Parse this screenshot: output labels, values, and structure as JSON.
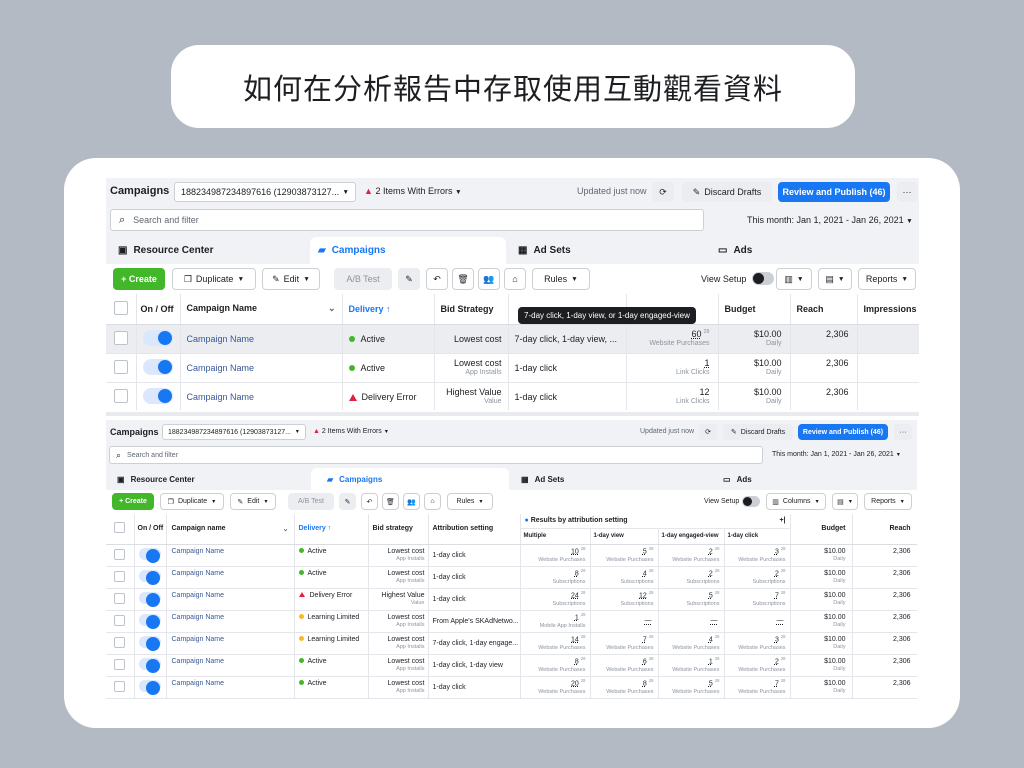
{
  "page_title": "如何在分析報告中存取使用互動觀看資料",
  "colors": {
    "accent": "#1877f2",
    "create": "#42b72a",
    "error": "#e41e3f",
    "active": "#42b72a",
    "limited": "#f7b928"
  },
  "shot1": {
    "toolbar": {
      "title": "Campaigns",
      "account": "188234987234897616 (12903873127...",
      "errors": "2 Items With Errors",
      "updated": "Updated just now",
      "discard": "Discard Drafts",
      "publish": "Review and Publish (46)",
      "more": "···"
    },
    "search": {
      "placeholder": "Search and filter",
      "date": "This month: Jan 1, 2021 - Jan 26, 2021"
    },
    "tabs": [
      "Resource Center",
      "Campaigns",
      "Ad Sets",
      "Ads"
    ],
    "actions": {
      "create": "+ Create",
      "duplicate": "Duplicate",
      "edit": "Edit",
      "ab": "A/B Test",
      "rules": "Rules",
      "view_setup": "View Setup",
      "reports": "Reports"
    },
    "tooltip": "7-day click, 1-day view, or 1-day engaged-view",
    "headers": [
      "On / Off",
      "Campaign Name",
      "Delivery ↑",
      "Bid Strategy",
      "",
      "",
      "Budget",
      "Reach",
      "Impressions"
    ],
    "rows": [
      {
        "name": "Campaign Name",
        "delivery": "Active",
        "bid": "Lowest cost",
        "bid_sub": "",
        "attr": "7-day click, 1-day view, ...",
        "result": "60",
        "result_sup": "28",
        "result_sub": "Website Purchases",
        "budget": "$10.00",
        "budget_sub": "Daily",
        "reach": "2,306"
      },
      {
        "name": "Campaign Name",
        "delivery": "Active",
        "bid": "Lowest cost",
        "bid_sub": "App Installs",
        "attr": "1-day click",
        "result": "1",
        "result_sup": "",
        "result_sub": "Link Clicks",
        "budget": "$10.00",
        "budget_sub": "Daily",
        "reach": "2,306"
      },
      {
        "name": "Campaign Name",
        "delivery": "Delivery Error",
        "bid": "Highest Value",
        "bid_sub": "Value",
        "attr": "1-day click",
        "result": "12",
        "result_sup": "",
        "result_sub": "Link Clicks",
        "budget": "$10.00",
        "budget_sub": "Daily",
        "reach": "2,306"
      }
    ]
  },
  "shot2": {
    "toolbar": {
      "title": "Campaigns",
      "account": "188234987234897616 (12903873127...",
      "errors": "2 Items With Errors",
      "updated": "Updated just now",
      "discard": "Discard Drafts",
      "publish": "Review and Publish (46)",
      "more": "···"
    },
    "search": {
      "placeholder": "Search and filter",
      "date": "This month: Jan 1, 2021 - Jan 26, 2021"
    },
    "tabs": [
      "Resource Center",
      "Campaigns",
      "Ad Sets",
      "Ads"
    ],
    "actions": {
      "create": "+ Create",
      "duplicate": "Duplicate",
      "edit": "Edit",
      "ab": "A/B Test",
      "rules": "Rules",
      "view_setup": "View Setup",
      "columns": "Columns",
      "reports": "Reports"
    },
    "results_label": "Results by attribution setting",
    "headers": [
      "On / Off",
      "Campaign name",
      "Delivery ↑",
      "Bid strategy",
      "Attribution setting",
      "Budget",
      "Reach"
    ],
    "sub_headers": [
      "Multiple",
      "1-day view",
      "1-day engaged-view",
      "1-day click"
    ],
    "rows": [
      {
        "name": "Campaign Name",
        "delivery": "Active",
        "dtype": "active",
        "bid": "Lowest cost",
        "bid_sub": "App Installs",
        "attr": "1-day click",
        "cells": [
          [
            "10",
            "28",
            "Website Purchases"
          ],
          [
            "5",
            "28",
            "Website Purchases"
          ],
          [
            "2",
            "28",
            "Website Purchases"
          ],
          [
            "3",
            "28",
            "Website Purchases"
          ]
        ],
        "budget": "$10.00",
        "reach": "2,306"
      },
      {
        "name": "Campaign Name",
        "delivery": "Active",
        "dtype": "active",
        "bid": "Lowest cost",
        "bid_sub": "App Installs",
        "attr": "1-day click",
        "cells": [
          [
            "8",
            "28",
            "Subscriptions"
          ],
          [
            "4",
            "28",
            "Subscriptions"
          ],
          [
            "2",
            "28",
            "Subscriptions"
          ],
          [
            "2",
            "28",
            "Subscriptions"
          ]
        ],
        "budget": "$10.00",
        "reach": "2,306"
      },
      {
        "name": "Campaign Name",
        "delivery": "Delivery Error",
        "dtype": "error",
        "bid": "Highest Value",
        "bid_sub": "Value",
        "attr": "1-day click",
        "cells": [
          [
            "24",
            "28",
            "Subscriptions"
          ],
          [
            "12",
            "28",
            "Subscriptions"
          ],
          [
            "5",
            "28",
            "Subscriptions"
          ],
          [
            "7",
            "28",
            "Subscriptions"
          ]
        ],
        "budget": "$10.00",
        "reach": "2,306"
      },
      {
        "name": "Campaign Name",
        "delivery": "Learning Limited",
        "dtype": "limited",
        "bid": "Lowest cost",
        "bid_sub": "App Installs",
        "attr": "From Apple's SKAdNetwo...",
        "cells": [
          [
            "1",
            "28",
            "Mobile App Installs"
          ],
          [
            "—",
            "",
            ""
          ],
          [
            "—",
            "",
            ""
          ],
          [
            "—",
            "",
            ""
          ]
        ],
        "budget": "$10.00",
        "reach": "2,306"
      },
      {
        "name": "Campaign Name",
        "delivery": "Learning Limited",
        "dtype": "limited",
        "bid": "Lowest cost",
        "bid_sub": "App Installs",
        "attr": "7-day click, 1-day engage...",
        "cells": [
          [
            "14",
            "28",
            "Website Purchases"
          ],
          [
            "7",
            "28",
            "Website Purchases"
          ],
          [
            "4",
            "28",
            "Website Purchases"
          ],
          [
            "3",
            "28",
            "Website Purchases"
          ]
        ],
        "budget": "$10.00",
        "reach": "2,306"
      },
      {
        "name": "Campaign Name",
        "delivery": "Active",
        "dtype": "active",
        "bid": "Lowest cost",
        "bid_sub": "App Installs",
        "attr": "1-day click, 1-day view",
        "cells": [
          [
            "8",
            "28",
            "Website Purchases"
          ],
          [
            "6",
            "28",
            "Website Purchases"
          ],
          [
            "1",
            "28",
            "Website Purchases"
          ],
          [
            "2",
            "28",
            "Website Purchases"
          ]
        ],
        "budget": "$10.00",
        "reach": "2,306"
      },
      {
        "name": "Campaign Name",
        "delivery": "Active",
        "dtype": "active",
        "bid": "Lowest cost",
        "bid_sub": "App Installs",
        "attr": "1-day click",
        "cells": [
          [
            "20",
            "28",
            "Website Purchases"
          ],
          [
            "8",
            "28",
            "Website Purchases"
          ],
          [
            "5",
            "28",
            "Website Purchases"
          ],
          [
            "7",
            "28",
            "Website Purchases"
          ]
        ],
        "budget": "$10.00",
        "reach": "2,306"
      }
    ]
  }
}
